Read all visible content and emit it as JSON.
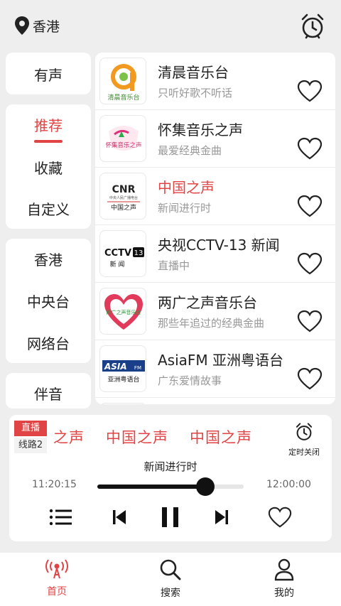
{
  "header": {
    "location": "香港"
  },
  "sidebar": {
    "group1": [
      "有声"
    ],
    "group2": [
      "推荐",
      "收藏",
      "自定义"
    ],
    "group3": [
      "香港",
      "中央台",
      "网络台"
    ],
    "group4": [
      "伴音"
    ]
  },
  "stations": [
    {
      "title": "清晨音乐台",
      "subtitle": "只听好歌不听话",
      "logo_text": "清晨音乐台"
    },
    {
      "title": "怀集音乐之声",
      "subtitle": "最爱经典金曲",
      "logo_text": "怀集音乐之声"
    },
    {
      "title": "中国之声",
      "subtitle": "新闻进行时",
      "logo_text_top": "CNR",
      "logo_text_small": "中央人民广播电台",
      "logo_text": "中国之声"
    },
    {
      "title": "央视CCTV-13 新闻",
      "subtitle": "直播中",
      "logo_text_top": "CCTV",
      "logo_num": "13",
      "logo_text": "新 闻"
    },
    {
      "title": "两广之声音乐台",
      "subtitle": "那些年追过的经典金曲",
      "logo_text": "两广之声音乐台"
    },
    {
      "title": "AsiaFM 亚洲粤语台",
      "subtitle": "广东爱情故事",
      "logo_text_top": "ASIA",
      "logo_fm": "FM",
      "logo_text": "亚洲粤语台"
    }
  ],
  "player": {
    "live_label": "直播",
    "line_label": "线路2",
    "marquee": [
      "之声",
      "中国之声",
      "中国之声"
    ],
    "timer_label": "定时关闭",
    "now_playing": "新闻进行时",
    "time_start": "11:20:15",
    "time_end": "12:00:00",
    "progress": 0.74
  },
  "tabs": [
    {
      "label": "首页",
      "icon": "radio-icon"
    },
    {
      "label": "搜索",
      "icon": "search-icon"
    },
    {
      "label": "我的",
      "icon": "user-icon"
    }
  ],
  "colors": {
    "accent": "#e04444",
    "text": "#222222",
    "muted": "#999999",
    "background": "#eeeeee"
  }
}
